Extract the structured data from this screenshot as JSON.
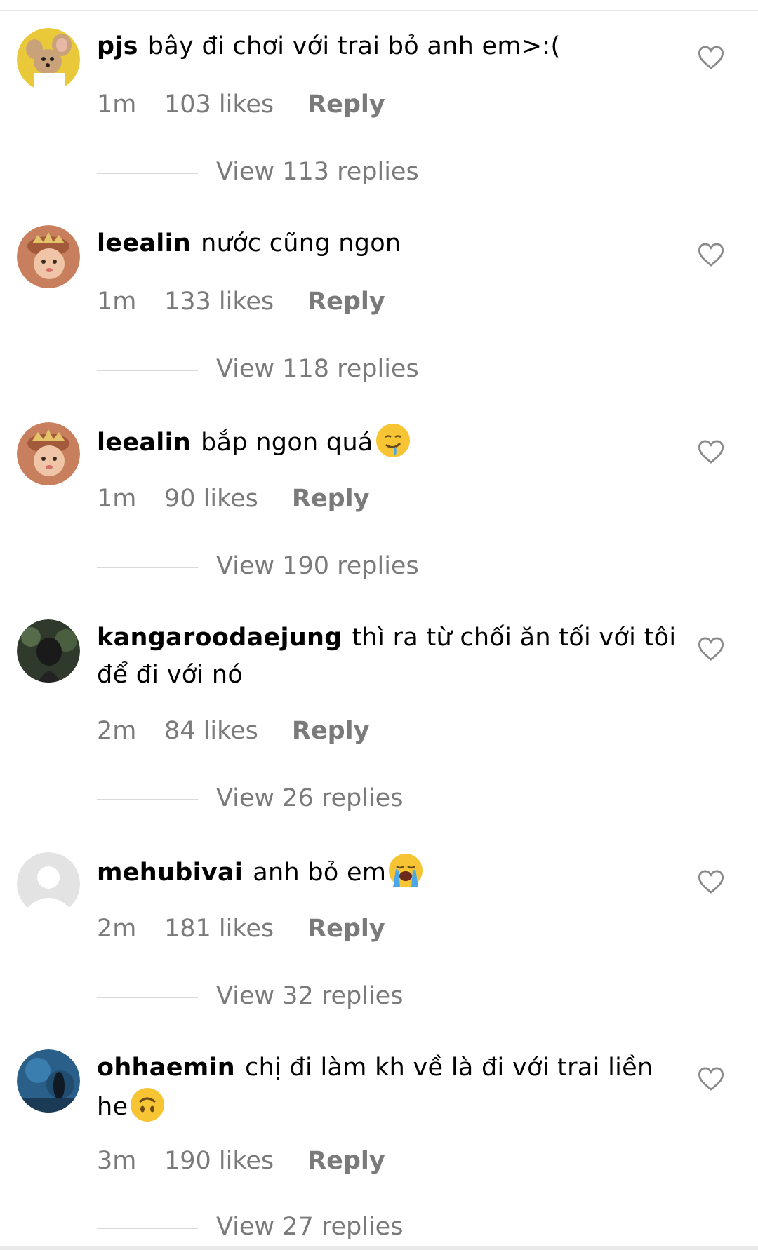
{
  "comments": [
    {
      "username": "pjs",
      "text": "bây đi chơi với trai bỏ anh em>:(",
      "time": "1m",
      "likes": "103 likes",
      "reply_label": "Reply",
      "view_replies": "View 113 replies"
    },
    {
      "username": "leealin",
      "text": "nước cũng ngon",
      "time": "1m",
      "likes": "133 likes",
      "reply_label": "Reply",
      "view_replies": "View 118 replies"
    },
    {
      "username": "leealin",
      "text": "bắp ngon quá",
      "emoji": "drooling-face-emoji",
      "time": "1m",
      "likes": "90 likes",
      "reply_label": "Reply",
      "view_replies": "View 190 replies"
    },
    {
      "username": "kangaroodaejung",
      "text": "thì ra từ chối ăn tối với tôi để đi với nó",
      "time": "2m",
      "likes": "84 likes",
      "reply_label": "Reply",
      "view_replies": "View 26 replies"
    },
    {
      "username": "mehubivai",
      "text": "anh bỏ em",
      "emoji": "loudly-crying-face-emoji",
      "time": "2m",
      "likes": "181 likes",
      "reply_label": "Reply",
      "view_replies": "View 32 replies"
    },
    {
      "username": "ohhaemin",
      "text": "chị đi làm kh về là đi với trai liền he",
      "emoji": "upside-down-face-emoji",
      "time": "3m",
      "likes": "190 likes",
      "reply_label": "Reply",
      "view_replies": "View 27 replies"
    }
  ],
  "icons": {
    "like": "heart-outline-icon"
  },
  "colors": {
    "meta_text": "#7a7a7a",
    "divider": "#d8d8d8",
    "emoji_yellow": "#f7c533"
  }
}
